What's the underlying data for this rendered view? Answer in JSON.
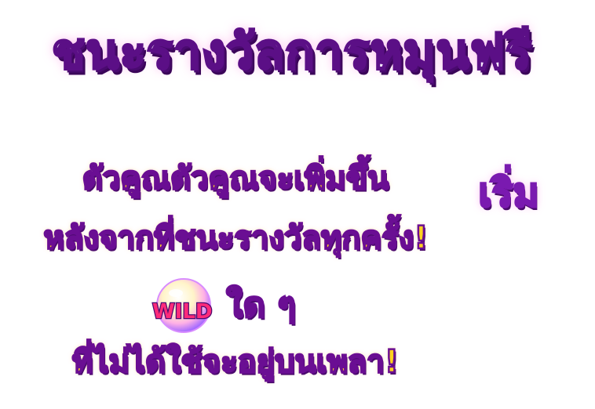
{
  "title": "ชนะรางวัลการหมุนฟรี",
  "start_label": "เริ่ม",
  "lines": {
    "line1": "ตัวคูณตัวคูณจะเพิ่มขึ้น",
    "line2": "หลังจากที่ชนะรางวัลทุกครั้ง!",
    "line3": "ใด ๆ",
    "line4": "ที่ไม่ได้ใช้จะอยู่บนเพลา!"
  },
  "wild_symbol": {
    "label": "WILD",
    "icon": "wild-bubble-icon"
  },
  "colors": {
    "title_fill": "#f7e9ff",
    "title_outline": "#5b0f86",
    "text_fill": "#ffd21f",
    "text_outline": "#6a0e93"
  }
}
